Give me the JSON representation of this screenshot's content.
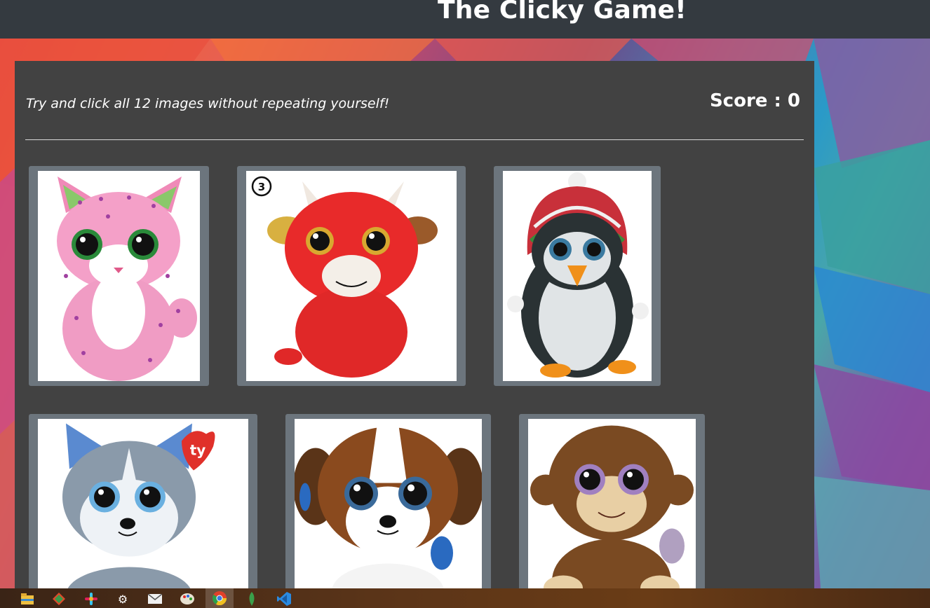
{
  "header": {
    "title": "The Clicky Game!"
  },
  "game": {
    "instructions": "Try and click all 12 images without repeating yourself!",
    "score_text": "Score : 0"
  },
  "cards": [
    {
      "name": "pink-cat-plush"
    },
    {
      "name": "red-cow-plush",
      "badge": "3"
    },
    {
      "name": "penguin-plush"
    },
    {
      "name": "husky-plush",
      "tag": "ty"
    },
    {
      "name": "st-bernard-plush"
    },
    {
      "name": "monkey-plush"
    }
  ],
  "taskbar": {
    "icons": [
      "file-explorer-icon",
      "git-icon",
      "slack-icon",
      "settings-icon",
      "mail-icon",
      "paint-icon",
      "chrome-icon",
      "mongodb-icon",
      "vscode-icon"
    ]
  },
  "colors": {
    "navbar": "#343a40",
    "panel": "#424242",
    "card_frame": "#6c757d"
  }
}
